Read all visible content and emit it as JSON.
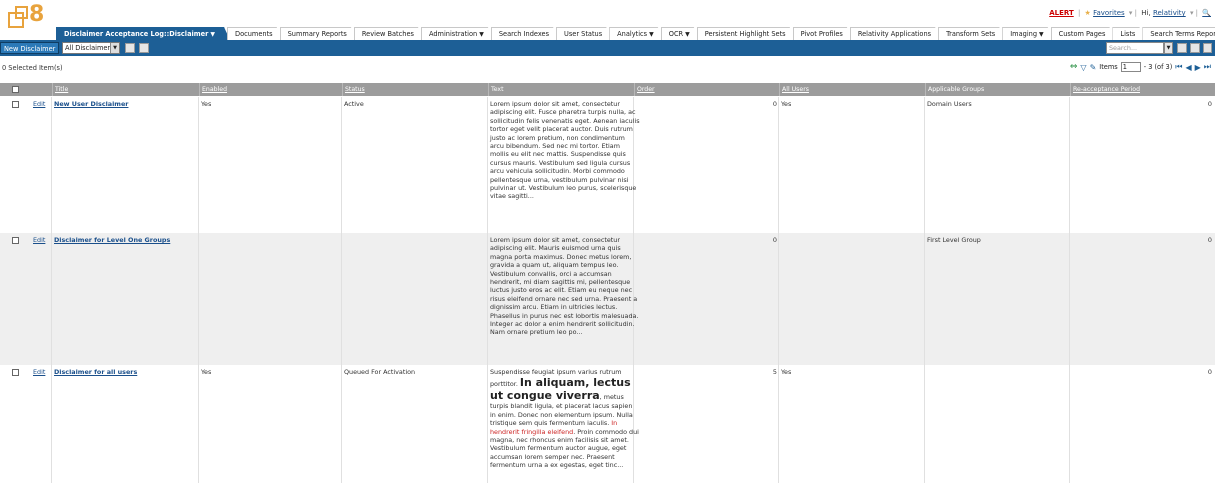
{
  "header": {
    "logo_text": "8",
    "alert": "ALERT",
    "favorites": "Favorites",
    "greeting": "Hi,",
    "user": "Relativity"
  },
  "tabs": [
    {
      "label": "Disclaimer Acceptance Log::Disclaimer",
      "active": true,
      "dropdown": true
    },
    {
      "label": "Documents"
    },
    {
      "label": "Summary Reports"
    },
    {
      "label": "Review Batches"
    },
    {
      "label": "Administration",
      "dropdown": true
    },
    {
      "label": "Search Indexes"
    },
    {
      "label": "User Status"
    },
    {
      "label": "Analytics",
      "dropdown": true
    },
    {
      "label": "OCR",
      "dropdown": true
    },
    {
      "label": "Persistent Highlight Sets"
    },
    {
      "label": "Pivot Profiles"
    },
    {
      "label": "Relativity Applications"
    },
    {
      "label": "Transform Sets"
    },
    {
      "label": "Imaging",
      "dropdown": true
    },
    {
      "label": "Custom Pages"
    },
    {
      "label": "Lists"
    },
    {
      "label": "Search Terms Report",
      "dropdown": true
    }
  ],
  "toolbar": {
    "new_label": "New Disclaimer",
    "view_selected": "All Disclaimers",
    "search_placeholder": "Search..."
  },
  "subrow": {
    "selected_text": "0 Selected Item(s)",
    "items_label": "Items",
    "page_value": "1",
    "range_text": "- 3 (of 3)"
  },
  "columns": [
    "Title",
    "Enabled",
    "Status",
    "Text",
    "Order",
    "All Users",
    "Applicable Groups",
    "Re-acceptance Period"
  ],
  "rows": [
    {
      "edit": "Edit",
      "title": "New User Disclaimer",
      "enabled": "Yes",
      "status": "Active",
      "text_parts": [
        {
          "t": "Lorem ipsum dolor sit amet, consectetur adipiscing elit. Fusce pharetra turpis nulla, ac sollicitudin felis venenatis eget. Aenean iaculis tortor eget velit placerat auctor. Duis rutrum justo ac lorem pretium, non condimentum arcu bibendum. Sed nec mi tortor. Etiam mollis eu elit nec mattis. Suspendisse quis cursus mauris. Vestibulum sed ligula cursus arcu vehicula sollicitudin. Morbi commodo pellentesque urna, vestibulum pulvinar nisi pulvinar ut. Vestibulum leo purus, scelerisque vitae sagitti..."
        }
      ],
      "order": "0",
      "all_users": "Yes",
      "groups": "Domain Users",
      "reaccept": "0"
    },
    {
      "edit": "Edit",
      "title": "Disclaimer for Level One Groups",
      "enabled": "",
      "status": "",
      "text_parts": [
        {
          "t": "Lorem ipsum dolor sit amet, consectetur adipiscing elit. Mauris euismod urna quis magna porta maximus. Donec metus lorem, gravida a quam ut, aliquam tempus leo. Vestibulum convallis, orci a accumsan hendrerit, mi diam sagittis mi, pellentesque luctus justo eros ac elit. Etiam eu neque nec risus eleifend ornare nec sed urna. Praesent a dignissim arcu. Etiam in ultricies lectus. Phasellus in purus nec est lobortis malesuada. Integer ac dolor a enim hendrerit sollicitudin. Nam ornare pretium leo po..."
        }
      ],
      "order": "0",
      "all_users": "",
      "groups": "First Level Group",
      "reaccept": "0"
    },
    {
      "edit": "Edit",
      "title": "Disclaimer for all users",
      "enabled": "Yes",
      "status": "Queued For Activation",
      "text_parts": [
        {
          "t": "Suspendisse feugiat ipsum varius rutrum porttitor. "
        },
        {
          "t": "In aliquam, lectus ut congue viverra",
          "style": "big"
        },
        {
          "t": ", metus turpis blandit ligula, et placerat lacus sapien in enim. Donec non elementum ipsum. Nulla tristique sem quis fermentum iaculis. "
        },
        {
          "t": "In hendrerit fringilla eleifend",
          "style": "red"
        },
        {
          "t": ". Proin commodo dui magna, nec rhoncus enim facilisis sit amet. Vestibulum fermentum auctor augue, eget accumsan lorem semper nec. Praesent fermentum urna a ex egestas, eget tinc..."
        }
      ],
      "order": "5",
      "all_users": "Yes",
      "groups": "",
      "reaccept": "0"
    }
  ],
  "colors": {
    "tab_active": "#1d5f96",
    "header_gray": "#9c9c9c",
    "logo": "#e8a33d",
    "link": "#1a4f8b"
  }
}
